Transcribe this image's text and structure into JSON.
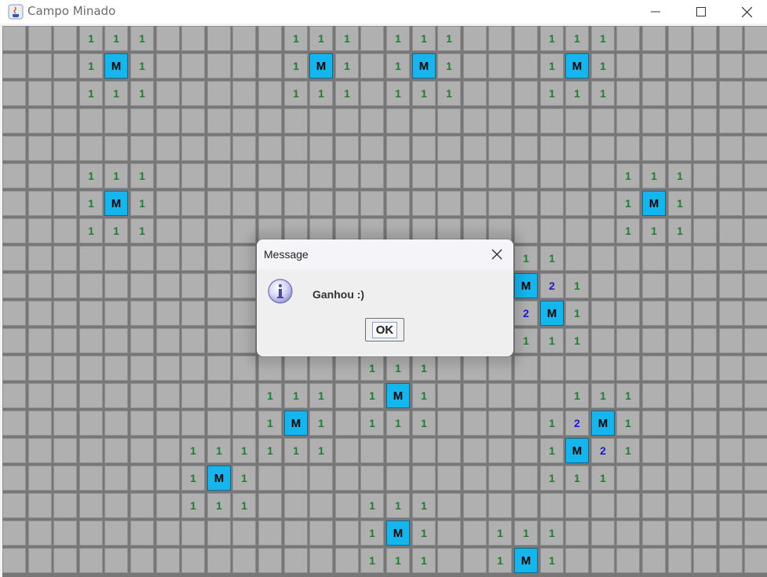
{
  "window": {
    "title": "Campo Minado",
    "controls": [
      "minimize-icon",
      "maximize-icon",
      "close-icon"
    ]
  },
  "board": {
    "columns": 30,
    "rows": 20,
    "colors": {
      "hidden": "#b0b0b0",
      "mine": "#15b6ee",
      "one": "#1e7e2f",
      "two": "#1a1ad8"
    },
    "cells": [
      [
        0,
        3,
        "1"
      ],
      [
        0,
        4,
        "1"
      ],
      [
        0,
        5,
        "1"
      ],
      [
        0,
        11,
        "1"
      ],
      [
        0,
        12,
        "1"
      ],
      [
        0,
        13,
        "1"
      ],
      [
        0,
        15,
        "1"
      ],
      [
        0,
        16,
        "1"
      ],
      [
        0,
        17,
        "1"
      ],
      [
        0,
        21,
        "1"
      ],
      [
        0,
        22,
        "1"
      ],
      [
        0,
        23,
        "1"
      ],
      [
        1,
        3,
        "1"
      ],
      [
        1,
        4,
        "M"
      ],
      [
        1,
        5,
        "1"
      ],
      [
        1,
        11,
        "1"
      ],
      [
        1,
        12,
        "M"
      ],
      [
        1,
        13,
        "1"
      ],
      [
        1,
        15,
        "1"
      ],
      [
        1,
        16,
        "M"
      ],
      [
        1,
        17,
        "1"
      ],
      [
        1,
        21,
        "1"
      ],
      [
        1,
        22,
        "M"
      ],
      [
        1,
        23,
        "1"
      ],
      [
        2,
        3,
        "1"
      ],
      [
        2,
        4,
        "1"
      ],
      [
        2,
        5,
        "1"
      ],
      [
        2,
        11,
        "1"
      ],
      [
        2,
        12,
        "1"
      ],
      [
        2,
        13,
        "1"
      ],
      [
        2,
        15,
        "1"
      ],
      [
        2,
        16,
        "1"
      ],
      [
        2,
        17,
        "1"
      ],
      [
        2,
        21,
        "1"
      ],
      [
        2,
        22,
        "1"
      ],
      [
        2,
        23,
        "1"
      ],
      [
        5,
        3,
        "1"
      ],
      [
        5,
        4,
        "1"
      ],
      [
        5,
        5,
        "1"
      ],
      [
        5,
        24,
        "1"
      ],
      [
        5,
        25,
        "1"
      ],
      [
        5,
        26,
        "1"
      ],
      [
        6,
        3,
        "1"
      ],
      [
        6,
        4,
        "M"
      ],
      [
        6,
        5,
        "1"
      ],
      [
        6,
        24,
        "1"
      ],
      [
        6,
        25,
        "M"
      ],
      [
        6,
        26,
        "1"
      ],
      [
        7,
        3,
        "1"
      ],
      [
        7,
        4,
        "1"
      ],
      [
        7,
        5,
        "1"
      ],
      [
        7,
        24,
        "1"
      ],
      [
        7,
        25,
        "1"
      ],
      [
        7,
        26,
        "1"
      ],
      [
        8,
        20,
        "1"
      ],
      [
        8,
        21,
        "1"
      ],
      [
        9,
        20,
        "M"
      ],
      [
        9,
        21,
        "2"
      ],
      [
        9,
        22,
        "1"
      ],
      [
        10,
        20,
        "2"
      ],
      [
        10,
        21,
        "M"
      ],
      [
        10,
        22,
        "1"
      ],
      [
        11,
        20,
        "1"
      ],
      [
        11,
        21,
        "1"
      ],
      [
        11,
        22,
        "1"
      ],
      [
        12,
        14,
        "1"
      ],
      [
        12,
        15,
        "1"
      ],
      [
        12,
        16,
        "1"
      ],
      [
        13,
        10,
        "1"
      ],
      [
        13,
        11,
        "1"
      ],
      [
        13,
        12,
        "1"
      ],
      [
        13,
        14,
        "1"
      ],
      [
        13,
        15,
        "M"
      ],
      [
        13,
        16,
        "1"
      ],
      [
        13,
        22,
        "1"
      ],
      [
        13,
        23,
        "1"
      ],
      [
        13,
        24,
        "1"
      ],
      [
        14,
        10,
        "1"
      ],
      [
        14,
        11,
        "M"
      ],
      [
        14,
        12,
        "1"
      ],
      [
        14,
        14,
        "1"
      ],
      [
        14,
        15,
        "1"
      ],
      [
        14,
        16,
        "1"
      ],
      [
        14,
        21,
        "1"
      ],
      [
        14,
        22,
        "2"
      ],
      [
        14,
        23,
        "M"
      ],
      [
        14,
        24,
        "1"
      ],
      [
        15,
        7,
        "1"
      ],
      [
        15,
        8,
        "1"
      ],
      [
        15,
        9,
        "1"
      ],
      [
        15,
        10,
        "1"
      ],
      [
        15,
        11,
        "1"
      ],
      [
        15,
        12,
        "1"
      ],
      [
        15,
        21,
        "1"
      ],
      [
        15,
        22,
        "M"
      ],
      [
        15,
        23,
        "2"
      ],
      [
        15,
        24,
        "1"
      ],
      [
        16,
        7,
        "1"
      ],
      [
        16,
        8,
        "M"
      ],
      [
        16,
        9,
        "1"
      ],
      [
        16,
        21,
        "1"
      ],
      [
        16,
        22,
        "1"
      ],
      [
        16,
        23,
        "1"
      ],
      [
        17,
        7,
        "1"
      ],
      [
        17,
        8,
        "1"
      ],
      [
        17,
        9,
        "1"
      ],
      [
        17,
        14,
        "1"
      ],
      [
        17,
        15,
        "1"
      ],
      [
        17,
        16,
        "1"
      ],
      [
        18,
        14,
        "1"
      ],
      [
        18,
        15,
        "M"
      ],
      [
        18,
        16,
        "1"
      ],
      [
        18,
        19,
        "1"
      ],
      [
        18,
        20,
        "1"
      ],
      [
        18,
        21,
        "1"
      ],
      [
        19,
        14,
        "1"
      ],
      [
        19,
        15,
        "1"
      ],
      [
        19,
        16,
        "1"
      ],
      [
        19,
        19,
        "1"
      ],
      [
        19,
        20,
        "M"
      ],
      [
        19,
        21,
        "1"
      ]
    ]
  },
  "dialog": {
    "title": "Message",
    "message": "Ganhou :)",
    "ok_label": "OK",
    "icon": "info-icon"
  }
}
